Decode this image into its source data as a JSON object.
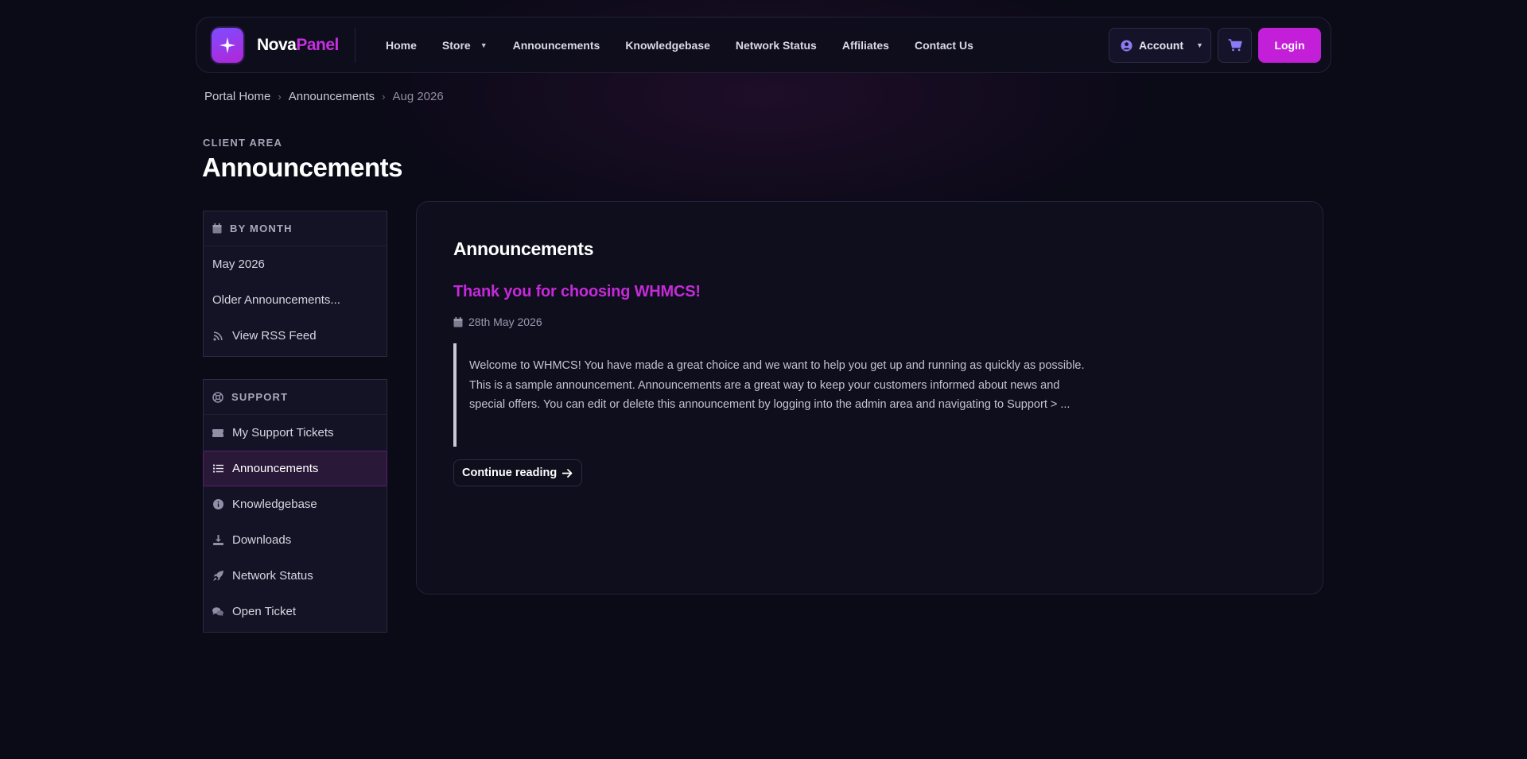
{
  "brand": {
    "name_a": "Nova",
    "name_b": "Panel",
    "accent": "#c41fd8"
  },
  "nav": {
    "items": [
      {
        "label": "Home"
      },
      {
        "label": "Store",
        "has_dropdown": true
      },
      {
        "label": "Announcements"
      },
      {
        "label": "Knowledgebase"
      },
      {
        "label": "Network Status"
      },
      {
        "label": "Affiliates"
      },
      {
        "label": "Contact Us"
      }
    ],
    "account_label": "Account",
    "login_label": "Login"
  },
  "breadcrumb": [
    "Portal Home",
    "Announcements",
    "Aug 2026"
  ],
  "page": {
    "eyebrow": "CLIENT AREA",
    "title": "Announcements"
  },
  "sidebar": {
    "by_month": {
      "heading": "BY MONTH",
      "icon": "calendar-icon",
      "items": [
        {
          "label": "May 2026"
        },
        {
          "label": "Older Announcements..."
        },
        {
          "label": "View RSS Feed",
          "icon": "rss-icon"
        }
      ]
    },
    "support": {
      "heading": "SUPPORT",
      "icon": "lifebuoy-icon",
      "items": [
        {
          "label": "My Support Tickets",
          "icon": "ticket-icon"
        },
        {
          "label": "Announcements",
          "icon": "list-icon",
          "active": true
        },
        {
          "label": "Knowledgebase",
          "icon": "info-icon"
        },
        {
          "label": "Downloads",
          "icon": "download-icon"
        },
        {
          "label": "Network Status",
          "icon": "rocket-icon"
        },
        {
          "label": "Open Ticket",
          "icon": "comments-icon"
        }
      ]
    }
  },
  "main": {
    "heading": "Announcements",
    "announcement": {
      "title": "Thank you for choosing WHMCS!",
      "date": "28th May 2026",
      "excerpt": "Welcome to WHMCS! You have made a great choice and we want to help you get up and running as quickly as possible. This is a sample announcement. Announcements are a great way to keep your customers informed about news and special offers. You can edit or delete this announcement by logging into the admin area and navigating to Support > ...",
      "continue_label": "Continue reading"
    }
  }
}
